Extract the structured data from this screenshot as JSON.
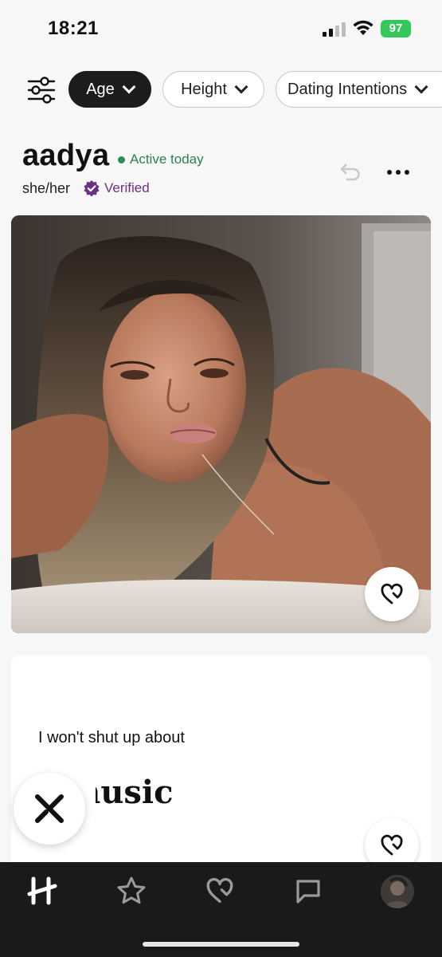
{
  "status_bar": {
    "time": "18:21",
    "battery": "97",
    "icons": [
      "signal-icon",
      "wifi-icon",
      "battery-icon"
    ]
  },
  "filters": {
    "icon": "sliders-icon",
    "chips": [
      {
        "label": "Age",
        "active": true
      },
      {
        "label": "Height",
        "active": false
      },
      {
        "label": "Dating Intentions",
        "active": false
      }
    ]
  },
  "profile": {
    "name": "aadya",
    "activity": "Active today",
    "pronouns": "she/her",
    "verified_label": "Verified"
  },
  "prompt": {
    "question": "I won't shut up about",
    "answer": "music"
  },
  "nav": {
    "items": [
      "home-logo-icon",
      "standouts-star-icon",
      "likes-heart-icon",
      "matches-chat-icon",
      "profile-avatar"
    ]
  },
  "colors": {
    "active_green": "#2e7d55",
    "verified_purple": "#6b2f86",
    "battery_green": "#34c759",
    "nav_background": "#1a1a1a"
  }
}
